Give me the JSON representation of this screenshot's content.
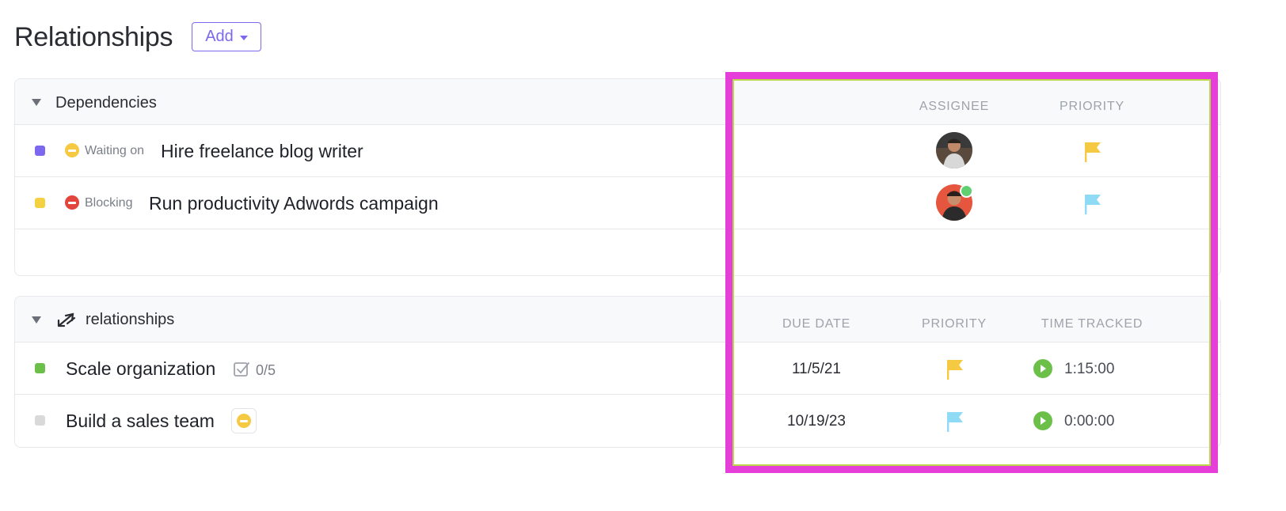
{
  "header": {
    "title": "Relationships",
    "add_label": "Add"
  },
  "dependencies": {
    "title": "Dependencies",
    "columns": [
      "ASSIGNEE",
      "PRIORITY"
    ],
    "rows": [
      {
        "color": "#7b68ee",
        "status": "Waiting on",
        "status_color": "#f5c942",
        "task": "Hire freelance blog writer",
        "priority_color": "#f5c942"
      },
      {
        "color": "#f5d142",
        "status": "Blocking",
        "status_color": "#e2453c",
        "task": "Run productivity Adwords campaign",
        "priority_color": "#8fdaf5"
      }
    ]
  },
  "relationships": {
    "title": "relationships",
    "columns": [
      "DUE DATE",
      "PRIORITY",
      "TIME TRACKED"
    ],
    "rows": [
      {
        "color": "#6cc04a",
        "task": "Scale organization",
        "subtasks": "0/5",
        "due": "11/5/21",
        "priority_color": "#f5c942",
        "time": "1:15:00"
      },
      {
        "color": "#d9d9d9",
        "task": "Build a sales team",
        "due": "10/19/23",
        "priority_color": "#8fdaf5",
        "time": "0:00:00"
      }
    ]
  },
  "icons": {
    "collapse": "triangle-down-icon",
    "relationship": "arrows-icon",
    "flag": "flag-icon",
    "play": "play-icon",
    "check": "checkbox-icon"
  },
  "highlight_color": "#e63fd9"
}
